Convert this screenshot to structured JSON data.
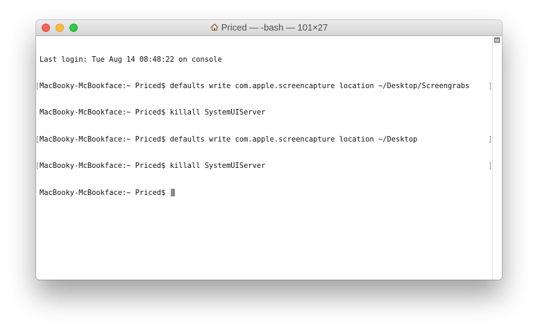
{
  "window": {
    "title": "Priced — -bash — 101×27",
    "title_icon": "home-icon"
  },
  "terminal": {
    "lines": [
      "Last login: Tue Aug 14 08:48:22 on console",
      "MacBooky-McBookface:~ Priced$ defaults write com.apple.screencapture location ~/Desktop/Screengrabs",
      "MacBooky-McBookface:~ Priced$ killall SystemUIServer",
      "MacBooky-McBookface:~ Priced$ defaults write com.apple.screencapture location ~/Desktop",
      "MacBooky-McBookface:~ Priced$ killall SystemUIServer",
      "MacBooky-McBookface:~ Priced$ "
    ]
  },
  "colors": {
    "close": "#fc605c",
    "minimize": "#fdbc40",
    "maximize": "#34c84a",
    "text": "#111111"
  }
}
